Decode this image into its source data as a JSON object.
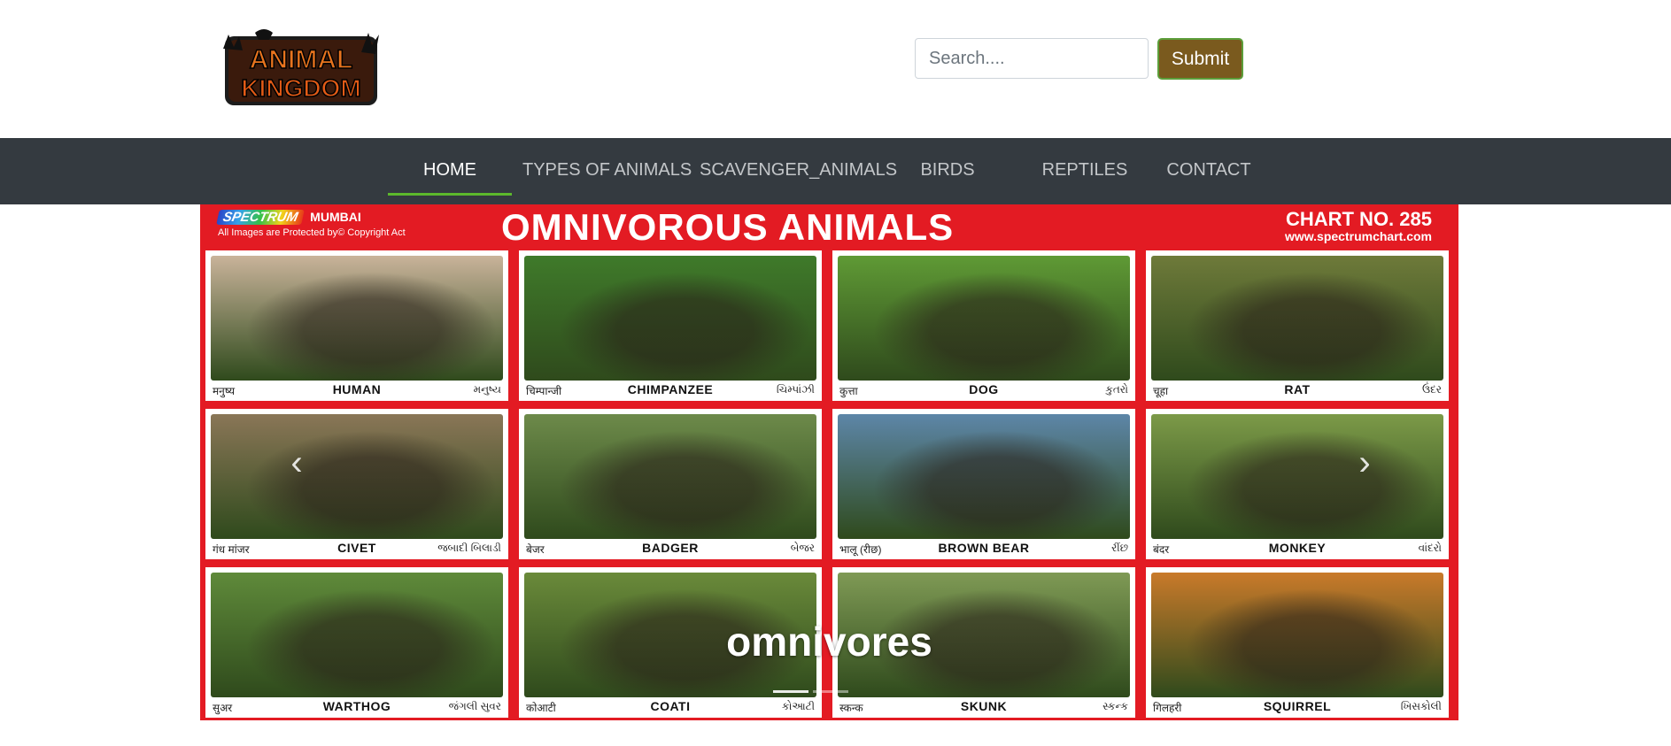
{
  "header": {
    "logo_alt": "Animal Kingdom",
    "logo_line1": "ANIMAL",
    "logo_line2": "KINGDOM",
    "search_placeholder": "Search....",
    "submit_label": "Submit"
  },
  "nav": {
    "items": [
      {
        "label": "HOME",
        "active": true
      },
      {
        "label": "TYPES OF ANIMALS",
        "active": false
      },
      {
        "label": "SCAVENGER_ANIMALS",
        "active": false
      },
      {
        "label": "BIRDS",
        "active": false
      },
      {
        "label": "REPTILES",
        "active": false
      },
      {
        "label": "CONTACT",
        "active": false
      }
    ]
  },
  "carousel": {
    "chart": {
      "brand": "SPECTRUM",
      "city": "MUMBAI",
      "copyright": "All Images are Protected by© Copyright Act",
      "title": "OMNIVOROUS ANIMALS",
      "chart_no": "CHART NO. 285",
      "url": "www.spectrumchart.com",
      "cards": [
        {
          "hi": "मनुष्य",
          "en": "HUMAN",
          "gu": "મનુષ્ય",
          "color": "#c9b39a"
        },
        {
          "hi": "चिम्पान्जी",
          "en": "CHIMPANZEE",
          "gu": "ચિમ્પાંઝી",
          "color": "#3f7a2a"
        },
        {
          "hi": "कुत्ता",
          "en": "DOG",
          "gu": "કુતરો",
          "color": "#5f9a35"
        },
        {
          "hi": "चूहा",
          "en": "RAT",
          "gu": "ઉંદર",
          "color": "#6e7a3a"
        },
        {
          "hi": "गंध मांजर",
          "en": "CIVET",
          "gu": "જબાદી બિલાડી",
          "color": "#8a7657"
        },
        {
          "hi": "बेजर",
          "en": "BADGER",
          "gu": "બેજર",
          "color": "#6d8a4a"
        },
        {
          "hi": "भालू (रीछ)",
          "en": "BROWN BEAR",
          "gu": "રીંછ",
          "color": "#5d86a8"
        },
        {
          "hi": "बंदर",
          "en": "MONKEY",
          "gu": "વાંદરો",
          "color": "#7c9a48"
        },
        {
          "hi": "सुअर",
          "en": "WARTHOG",
          "gu": "જંગલી સુવર",
          "color": "#5f8a3a"
        },
        {
          "hi": "कोआटी",
          "en": "COATI",
          "gu": "કોઆટી",
          "color": "#6a8a3a"
        },
        {
          "hi": "स्कन्क",
          "en": "SKUNK",
          "gu": "સ્કન્ક",
          "color": "#7f9a55"
        },
        {
          "hi": "गिलहरी",
          "en": "SQUIRREL",
          "gu": "ખિસકોલી",
          "color": "#c97a2a"
        }
      ]
    },
    "caption": "omnivores",
    "prev_icon": "‹",
    "next_icon": "›"
  },
  "colors": {
    "nav_bg": "#343a40",
    "nav_active_underline": "#5cb82c",
    "submit_bg": "#7a5a1e",
    "chart_bg": "#e31b23"
  }
}
